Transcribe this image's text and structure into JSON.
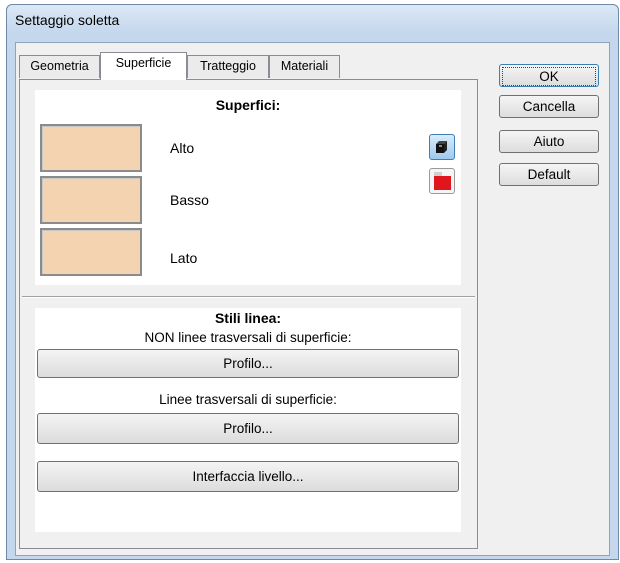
{
  "window": {
    "title": "Settaggio soletta"
  },
  "tabs": [
    "Geometria",
    "Superficie",
    "Tratteggio",
    "Materiali"
  ],
  "active_tab": "Superficie",
  "surfaces": {
    "heading": "Superfici:",
    "items": [
      {
        "label": "Alto",
        "color": "#f4d3b0"
      },
      {
        "label": "Basso",
        "color": "#f4d3b0"
      },
      {
        "label": "Lato",
        "color": "#f4d3b0"
      }
    ],
    "icons": [
      "3d-cube-icon",
      "color-red-icon"
    ]
  },
  "line_styles": {
    "heading": "Stili linea:",
    "non_cross_label": "NON linee trasversali di superficie:",
    "non_cross_button": "Profilo...",
    "cross_label": "Linee trasversali di superficie:",
    "cross_button": "Profilo...",
    "interface_button": "Interfaccia livello..."
  },
  "buttons": {
    "ok": "OK",
    "cancel": "Cancella",
    "help": "Aiuto",
    "default": "Default"
  },
  "colors": {
    "swatch": "#f4d3b0",
    "accent_red": "#e0161c",
    "window_frame": "#c4d7ec"
  }
}
